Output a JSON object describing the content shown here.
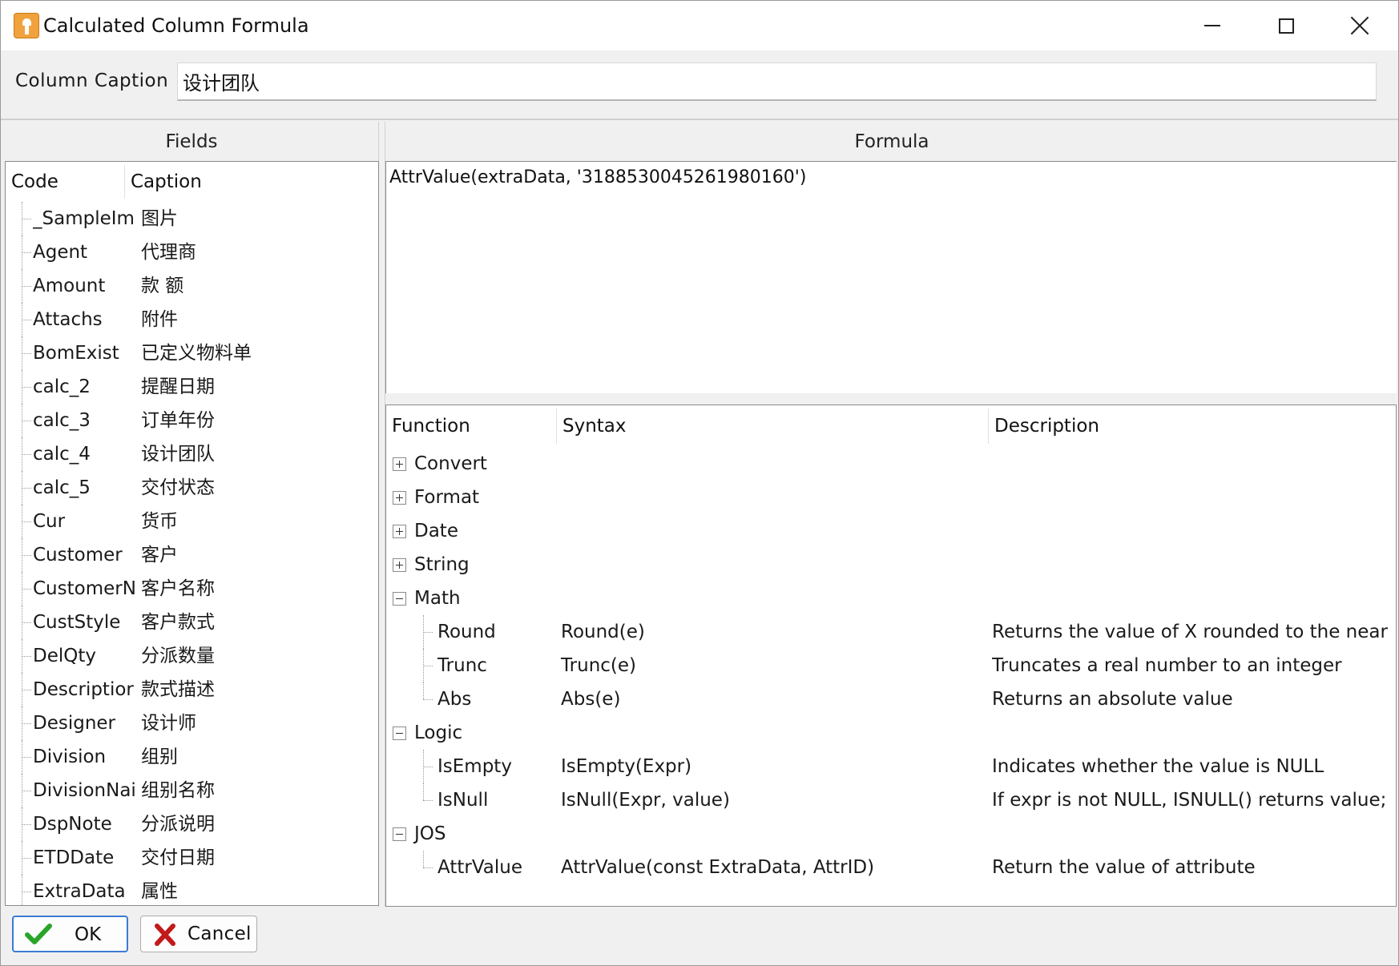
{
  "window": {
    "title": "Calculated Column Formula"
  },
  "caption": {
    "label": "Column Caption",
    "value": "设计团队"
  },
  "fields": {
    "header": "Fields",
    "columns": [
      "Code",
      "Caption"
    ],
    "rows": [
      {
        "code": "_SampleIm",
        "caption": "图片"
      },
      {
        "code": "Agent",
        "caption": "代理商"
      },
      {
        "code": "Amount",
        "caption": "款 额"
      },
      {
        "code": "Attachs",
        "caption": "附件"
      },
      {
        "code": "BomExist",
        "caption": "已定义物料单"
      },
      {
        "code": "calc_2",
        "caption": "提醒日期"
      },
      {
        "code": "calc_3",
        "caption": "订单年份"
      },
      {
        "code": "calc_4",
        "caption": "设计团队"
      },
      {
        "code": "calc_5",
        "caption": "交付状态"
      },
      {
        "code": "Cur",
        "caption": "货币"
      },
      {
        "code": "Customer",
        "caption": "客户"
      },
      {
        "code": "CustomerN",
        "caption": "客户名称"
      },
      {
        "code": "CustStyle",
        "caption": "客户款式"
      },
      {
        "code": "DelQty",
        "caption": "分派数量"
      },
      {
        "code": "Descriptior",
        "caption": "款式描述"
      },
      {
        "code": "Designer",
        "caption": "设计师"
      },
      {
        "code": "Division",
        "caption": "组别"
      },
      {
        "code": "DivisionNai",
        "caption": "组别名称"
      },
      {
        "code": "DspNote",
        "caption": "分派说明"
      },
      {
        "code": "ETDDate",
        "caption": "交付日期"
      },
      {
        "code": "ExtraData",
        "caption": "属性"
      }
    ]
  },
  "formula": {
    "header": "Formula",
    "text": "AttrValue(extraData, '3188530045261980160')"
  },
  "functions": {
    "columns": [
      "Function",
      "Syntax",
      "Description"
    ],
    "groups": [
      {
        "name": "Convert",
        "expanded": false,
        "items": []
      },
      {
        "name": "Format",
        "expanded": false,
        "items": []
      },
      {
        "name": "Date",
        "expanded": false,
        "items": []
      },
      {
        "name": "String",
        "expanded": false,
        "items": []
      },
      {
        "name": "Math",
        "expanded": true,
        "items": [
          {
            "name": "Round",
            "syntax": "Round(e)",
            "description": "Returns the value of X rounded to the near"
          },
          {
            "name": "Trunc",
            "syntax": "Trunc(e)",
            "description": "Truncates a real number to an integer"
          },
          {
            "name": "Abs",
            "syntax": "Abs(e)",
            "description": "Returns an absolute value"
          }
        ]
      },
      {
        "name": "Logic",
        "expanded": true,
        "items": [
          {
            "name": "IsEmpty",
            "syntax": "IsEmpty(Expr)",
            "description": "Indicates whether the value is NULL"
          },
          {
            "name": "IsNull",
            "syntax": "IsNull(Expr, value)",
            "description": "If expr is not NULL, ISNULL() returns value;"
          }
        ]
      },
      {
        "name": "JOS",
        "expanded": true,
        "items": [
          {
            "name": "AttrValue",
            "syntax": "AttrValue(const ExtraData, AttrID)",
            "description": "Return the value of attribute"
          }
        ]
      }
    ]
  },
  "buttons": {
    "ok": "OK",
    "cancel": "Cancel"
  },
  "colors": {
    "accent": "#3b7bd4",
    "check": "#2aa52a",
    "cancel_x": "#c21a1a",
    "app_icon": "#f0a23c"
  }
}
